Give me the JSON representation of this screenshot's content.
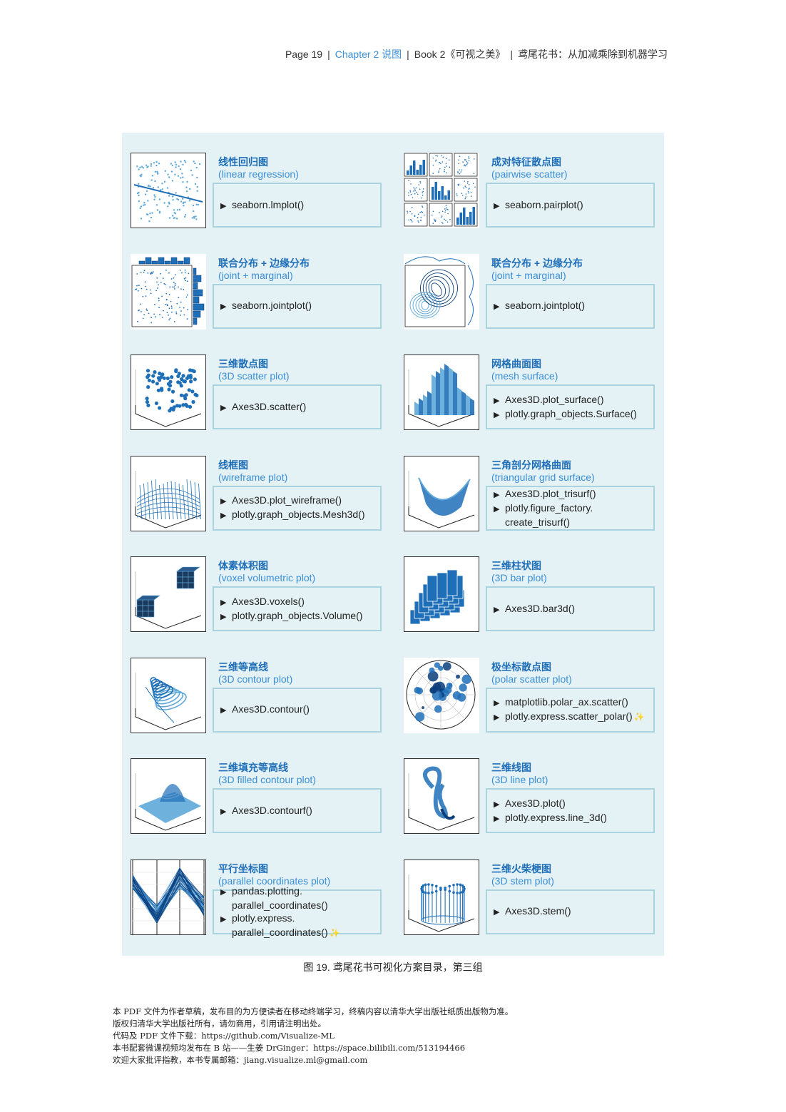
{
  "header": {
    "page": "Page 19",
    "chapter": "Chapter 2 说图",
    "book": "Book 2《可视之美》",
    "series": "鸢尾花书：从加减乘除到机器学习"
  },
  "items": [
    {
      "zh": "线性回归图",
      "en": "(linear regression)",
      "code": [
        {
          "text": "seaborn.lmplot()",
          "arrow": true
        }
      ],
      "icon": "linear-regression-plot-icon"
    },
    {
      "zh": "成对特征散点图",
      "en": "(pairwise scatter)",
      "code": [
        {
          "text": "seaborn.pairplot()",
          "arrow": true
        }
      ],
      "icon": "pairwise-scatter-plot-icon"
    },
    {
      "zh": "联合分布 + 边缘分布",
      "en": "(joint + marginal)",
      "code": [
        {
          "text": "seaborn.jointplot()",
          "arrow": true
        }
      ],
      "icon": "joint-marginal-scatter-icon"
    },
    {
      "zh": "联合分布 + 边缘分布",
      "en": "(joint + marginal)",
      "code": [
        {
          "text": "seaborn.jointplot()",
          "arrow": true
        }
      ],
      "icon": "joint-marginal-kde-icon"
    },
    {
      "zh": "三维散点图",
      "en": "(3D scatter plot)",
      "code": [
        {
          "text": "Axes3D.scatter()",
          "arrow": true
        }
      ],
      "icon": "3d-scatter-plot-icon"
    },
    {
      "zh": "网格曲面图",
      "en": "(mesh surface)",
      "code": [
        {
          "text": "Axes3D.plot_surface()",
          "arrow": true
        },
        {
          "text": "plotly.graph_objects.Surface()",
          "arrow": true
        }
      ],
      "icon": "mesh-surface-icon"
    },
    {
      "zh": "线框图",
      "en": "(wireframe plot)",
      "code": [
        {
          "text": "Axes3D.plot_wireframe()",
          "arrow": true
        },
        {
          "text": "plotly.graph_objects.Mesh3d()",
          "arrow": true
        }
      ],
      "icon": "wireframe-plot-icon"
    },
    {
      "zh": "三角剖分网格曲面",
      "en": "(triangular grid surface)",
      "code": [
        {
          "text": "Axes3D.plot_trisurf()",
          "arrow": true
        },
        {
          "text": "plotly.figure_factory.",
          "arrow": true
        },
        {
          "text": "create_trisurf()",
          "arrow": false
        }
      ],
      "icon": "triangular-surface-icon"
    },
    {
      "zh": "体素体积图",
      "en": "(voxel volumetric plot)",
      "code": [
        {
          "text": "Axes3D.voxels()",
          "arrow": true
        },
        {
          "text": "plotly.graph_objects.Volume()",
          "arrow": true
        }
      ],
      "icon": "voxel-plot-icon"
    },
    {
      "zh": "三维柱状图",
      "en": "(3D bar plot)",
      "code": [
        {
          "text": "Axes3D.bar3d()",
          "arrow": true
        }
      ],
      "icon": "3d-bar-plot-icon"
    },
    {
      "zh": "三维等高线",
      "en": "(3D contour plot)",
      "code": [
        {
          "text": "Axes3D.contour()",
          "arrow": true
        }
      ],
      "icon": "3d-contour-plot-icon"
    },
    {
      "zh": "极坐标散点图",
      "en": "(polar scatter plot)",
      "code": [
        {
          "text": "matplotlib.polar_ax.scatter()",
          "arrow": true
        },
        {
          "text": "plotly.express.scatter_polar()",
          "arrow": true,
          "spark": true
        }
      ],
      "icon": "polar-scatter-plot-icon"
    },
    {
      "zh": "三维填充等高线",
      "en": "(3D filled contour plot)",
      "code": [
        {
          "text": "Axes3D.contourf()",
          "arrow": true
        }
      ],
      "icon": "3d-filled-contour-icon"
    },
    {
      "zh": "三维线图",
      "en": "(3D line plot)",
      "code": [
        {
          "text": "Axes3D.plot()",
          "arrow": true
        },
        {
          "text": "plotly.express.line_3d()",
          "arrow": true
        }
      ],
      "icon": "3d-line-plot-icon"
    },
    {
      "zh": "平行坐标图",
      "en": "(parallel coordinates plot)",
      "code": [
        {
          "text": "pandas.plotting.",
          "arrow": true
        },
        {
          "text": "parallel_coordinates()",
          "arrow": false
        },
        {
          "text": "plotly.express.",
          "arrow": true
        },
        {
          "text": "parallel_coordinates()",
          "arrow": false,
          "spark": true
        }
      ],
      "icon": "parallel-coordinates-icon"
    },
    {
      "zh": "三维火柴梗图",
      "en": "(3D stem plot)",
      "code": [
        {
          "text": "Axes3D.stem()",
          "arrow": true
        }
      ],
      "icon": "3d-stem-plot-icon"
    }
  ],
  "caption": "图 19. 鸢尾花书可视化方案目录，第三组",
  "footer": [
    "本 PDF 文件为作者草稿，发布目的为方便读者在移动终端学习，终稿内容以清华大学出版社纸质出版物为准。",
    "版权归清华大学出版社所有，请勿商用，引用请注明出处。",
    "代码及 PDF 文件下载：https://github.com/Visualize-ML",
    "本书配套微课视频均发布在 B 站——生姜 DrGinger：https://space.bilibili.com/513194466",
    "欢迎大家批评指教，本书专属邮箱：jiang.visualize.ml@gmail.com"
  ],
  "colors": {
    "panel": "#e4f1f5",
    "accent": "#1f6fb8",
    "border": "#a9d3df"
  }
}
